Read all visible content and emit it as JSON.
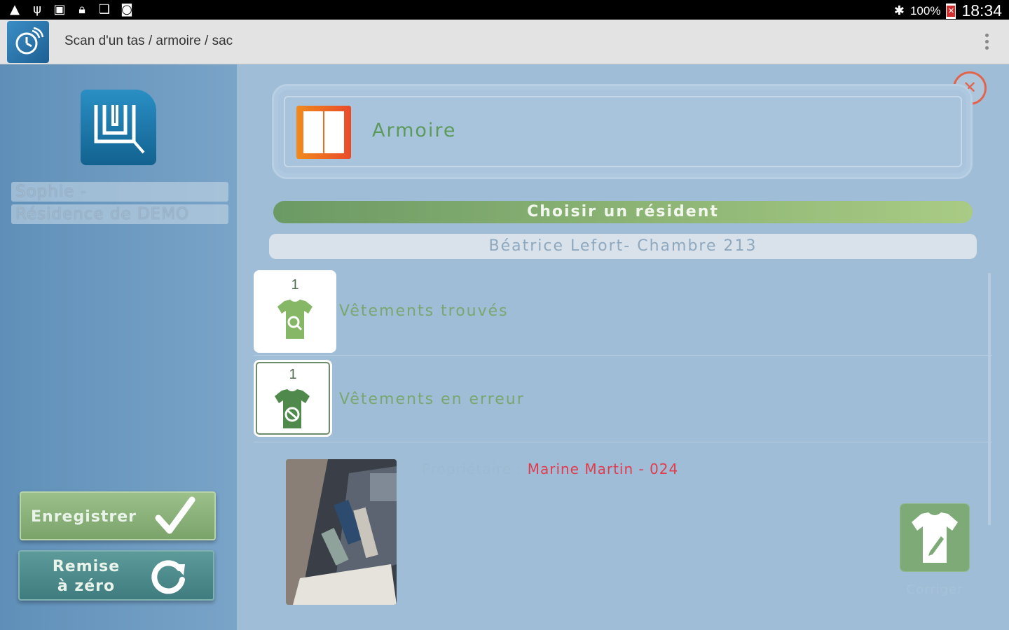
{
  "status_bar": {
    "icons_left": [
      "warning-icon",
      "usb-icon",
      "image-icon",
      "lock-icon",
      "photos-icon",
      "camera-icon"
    ],
    "bluetooth_icon": "bluetooth-icon",
    "battery_percent": "100%",
    "time": "18:34"
  },
  "action_bar": {
    "title": "Scan d'un tas / armoire / sac",
    "menu_icon": "overflow-menu-icon"
  },
  "sidebar": {
    "user_name": "Sophie  -",
    "residence": "Résidence de DEMO",
    "save_label": "Enregistrer",
    "reset_label_line1": "Remise",
    "reset_label_line2": "à zéro"
  },
  "container": {
    "label": "Armoire",
    "icon": "wardrobe-icon"
  },
  "choose_resident_label": "Choisir un résident",
  "selected_resident": "Béatrice Lefort- Chambre  213",
  "rows": [
    {
      "count": "1",
      "label": "Vêtements trouvés",
      "icon": "shirt-search-icon"
    },
    {
      "count": "1",
      "label": "Vêtements en erreur",
      "icon": "shirt-forbidden-icon"
    }
  ],
  "owner": {
    "key": "Propriétaire : ",
    "value": "Marine Martin - 024"
  },
  "fix_label": "Corriger",
  "colors": {
    "accent_green": "#78a870",
    "error_red": "#e03c4e",
    "close_red": "#e2644d",
    "wardrobe_orange": "#f08a1c"
  }
}
